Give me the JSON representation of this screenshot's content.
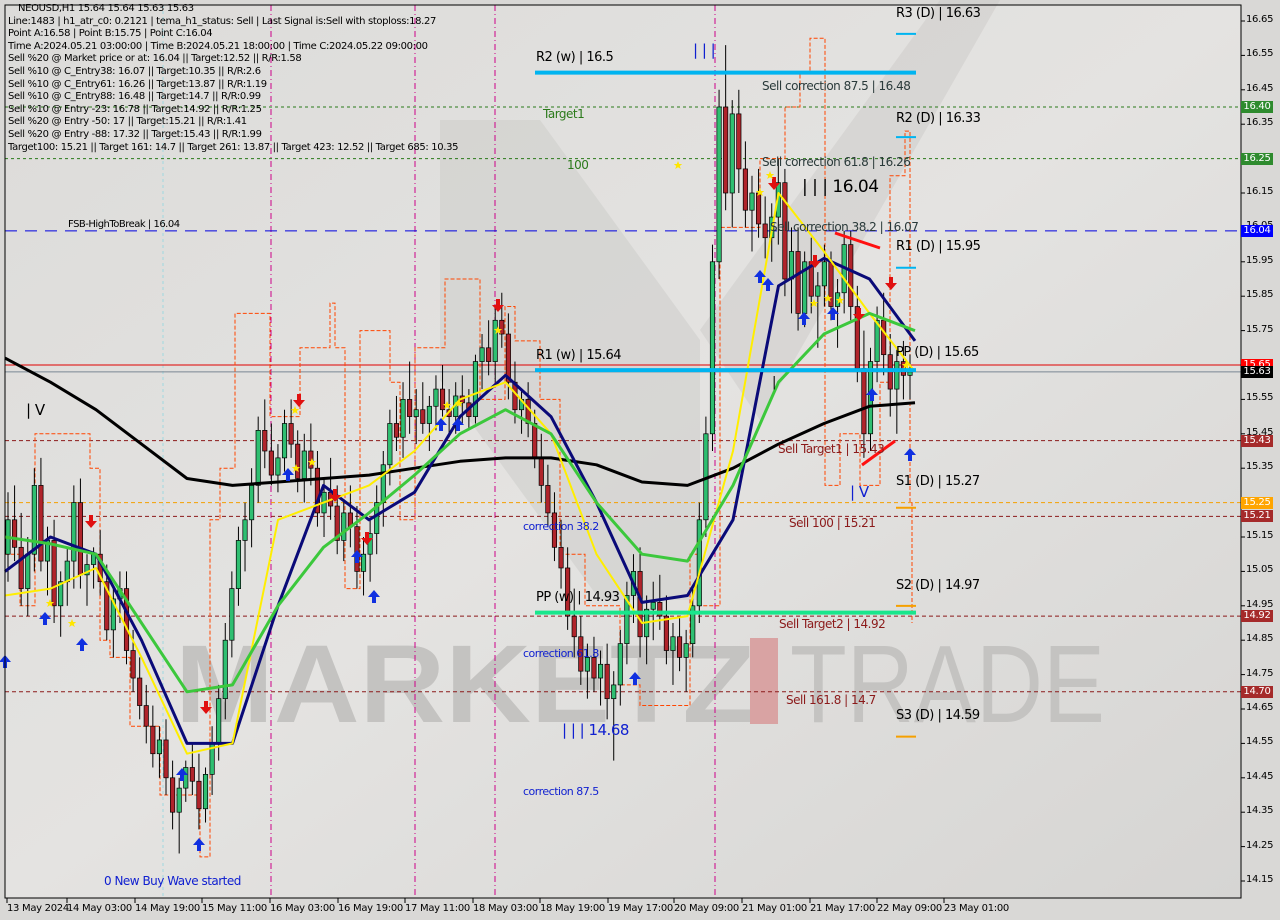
{
  "header": {
    "symbol_line": "NEOUSD,H1  15.64 15.64 15.63 15.63",
    "lines": [
      "Line:1483 | h1_atr_c0: 0.2121 | tema_h1_status: Sell | Last Signal is:Sell with stoploss:18.27",
      "Point A:16.58 | Point B:15.75 | Point C:16.04",
      "Time A:2024.05.21 03:00:00 | Time B:2024.05.21 18:00:00 | Time C:2024.05.22 09:00:00",
      "Sell %20 @ Market price or at: 16.04 || Target:12.52 || R/R:1.58",
      "Sell %10 @ C_Entry38: 16.07 || Target:10.35 || R/R:2.6",
      "Sell %10 @ C_Entry61: 16.26 || Target:13.87 || R/R:1.19",
      "Sell %10 @ C_Entry88: 16.48 || Target:14.7 || R/R:0.99",
      "Sell %10 @ Entry -23: 16.78 || Target:14.92 || R/R:1.25",
      "Sell %20 @ Entry -50: 17 || Target:15.21 || R/R:1.41",
      "Sell %20 @ Entry -88: 17.32 || Target:15.43 || R/R:1.99",
      "Target100: 15.21 || Target 161: 14.7 || Target 261: 13.87 || Target 423: 12.52 || Target 685: 10.35"
    ]
  },
  "watermark": {
    "left": "MARKETZ",
    "right": "TRADE"
  },
  "colors": {
    "background": "#d9d8d6",
    "bull_candle": "#2fbf71",
    "bear_candle": "#b0242b",
    "pivot_weekly": "#00b4f0",
    "pivot_pp_weekly": "#19e68c",
    "pivot_support_daily": "#f5a000",
    "fsb_line": "#0000e0",
    "target_line": "#2a7a1a",
    "sell_level": "#8b1a1a",
    "ma_black": "#000000",
    "ma_navy": "#0a0a78",
    "ma_yellow": "#ffee00",
    "ma_green": "#3cc83c",
    "orange_step": "#ff4500",
    "vline": "#cc0088"
  },
  "chart_data": {
    "type": "candlestick",
    "title": "NEOUSD,H1",
    "ylim": [
      14.1,
      16.7
    ],
    "y_ticks": [
      16.65,
      16.55,
      16.45,
      16.35,
      16.25,
      16.15,
      16.05,
      15.95,
      15.85,
      15.75,
      15.65,
      15.55,
      15.45,
      15.35,
      15.25,
      15.15,
      15.05,
      14.95,
      14.85,
      14.75,
      14.65,
      14.55,
      14.45,
      14.35,
      14.25,
      14.15
    ],
    "x_ticks": [
      "13 May 2024",
      "14 May 03:00",
      "14 May 19:00",
      "15 May 11:00",
      "16 May 03:00",
      "16 May 19:00",
      "17 May 11:00",
      "18 May 03:00",
      "18 May 19:00",
      "19 May 17:00",
      "20 May 09:00",
      "21 May 01:00",
      "21 May 17:00",
      "22 May 09:00",
      "23 May 01:00"
    ],
    "last_price": 15.63,
    "price_tags": [
      {
        "value": 16.4,
        "label": "16.40",
        "color": "#2e8b2e"
      },
      {
        "value": 16.25,
        "label": "16.25",
        "color": "#2e8b2e"
      },
      {
        "value": 16.04,
        "label": "16.04",
        "color": "#0000ff"
      },
      {
        "value": 15.65,
        "label": "15.65",
        "color": "#ff0000"
      },
      {
        "value": 15.63,
        "label": "15.63",
        "color": "#000000"
      },
      {
        "value": 15.43,
        "label": "15.43",
        "color": "#a52a2a"
      },
      {
        "value": 15.25,
        "label": "15.25",
        "color": "#ffa500"
      },
      {
        "value": 15.21,
        "label": "15.21",
        "color": "#a52a2a"
      },
      {
        "value": 14.92,
        "label": "14.92",
        "color": "#a52a2a"
      },
      {
        "value": 14.7,
        "label": "14.70",
        "color": "#a52a2a"
      }
    ],
    "levels": [
      {
        "name": "R2 (w)",
        "value": 16.5,
        "label": "R2 (w) | 16.5",
        "kind": "weekly"
      },
      {
        "name": "R1 (w)",
        "value": 15.64,
        "label": "R1 (w) | 15.64",
        "kind": "weekly"
      },
      {
        "name": "PP (w)",
        "value": 14.93,
        "label": "PP (w) | 14.93",
        "kind": "weekly_pp"
      },
      {
        "name": "R3 (D)",
        "value": 16.63,
        "label": "R3 (D) | 16.63",
        "kind": "daily_r"
      },
      {
        "name": "R2 (D)",
        "value": 16.33,
        "label": "R2 (D) | 16.33",
        "kind": "daily_r"
      },
      {
        "name": "R1 (D)",
        "value": 15.95,
        "label": "R1 (D) | 15.95",
        "kind": "daily_r"
      },
      {
        "name": "PP (D)",
        "value": 15.65,
        "label": "PP (D) | 15.65",
        "kind": "daily_pp"
      },
      {
        "name": "S1 (D)",
        "value": 15.27,
        "label": "S1 (D) | 15.27",
        "kind": "daily_s"
      },
      {
        "name": "S2 (D)",
        "value": 14.97,
        "label": "S2 (D) | 14.97",
        "kind": "daily_s"
      },
      {
        "name": "S3 (D)",
        "value": 14.59,
        "label": "S3 (D) | 14.59",
        "kind": "daily_s"
      }
    ],
    "annotations": [
      {
        "text": "Target1",
        "value": 16.4
      },
      {
        "text": "100",
        "value": 16.25
      },
      {
        "text": "FSB-HighToBreak | 16.04",
        "value": 16.04
      },
      {
        "text": "Sell correction 87.5 | 16.48",
        "value": 16.48
      },
      {
        "text": "Sell correction 61.8 | 16.26",
        "value": 16.26
      },
      {
        "text": "Sell correction 38.2 | 16.07",
        "value": 16.07
      },
      {
        "text": "| | | 16.04",
        "value": 16.15
      },
      {
        "text": "Sell Target1 | 15.43",
        "value": 15.43
      },
      {
        "text": "Sell 100 | 15.21",
        "value": 15.21
      },
      {
        "text": "Sell Target2 | 14.92",
        "value": 14.92
      },
      {
        "text": "Sell 161.8 | 14.7",
        "value": 14.7
      },
      {
        "text": "correction 38.2",
        "value": 15.2
      },
      {
        "text": "correction 61.8",
        "value": 14.8
      },
      {
        "text": "correction 87.5",
        "value": 14.42
      },
      {
        "text": "| | | 14.68",
        "value": 14.61
      },
      {
        "text": "0 New Buy Wave started",
        "value": 14.19
      },
      {
        "text": "| V",
        "value": 15.51
      },
      {
        "text": "| V",
        "value": 15.25
      },
      {
        "text": "| | |",
        "value": 16.55
      },
      {
        "text": "|",
        "value": 15.59
      }
    ],
    "candles_ohlc": [
      [
        15.1,
        15.28,
        15.02,
        15.2
      ],
      [
        15.2,
        15.3,
        15.08,
        15.12
      ],
      [
        15.12,
        15.22,
        14.95,
        15.0
      ],
      [
        15.0,
        15.15,
        14.92,
        15.1
      ],
      [
        15.1,
        15.35,
        15.05,
        15.3
      ],
      [
        15.3,
        15.38,
        15.05,
        15.08
      ],
      [
        15.08,
        15.18,
        14.98,
        15.14
      ],
      [
        15.14,
        15.2,
        14.9,
        14.95
      ],
      [
        14.95,
        15.05,
        14.86,
        15.02
      ],
      [
        15.02,
        15.12,
        14.95,
        15.08
      ],
      [
        15.08,
        15.3,
        15.0,
        15.25
      ],
      [
        15.25,
        15.32,
        15.0,
        15.04
      ],
      [
        15.04,
        15.1,
        14.95,
        15.07
      ],
      [
        15.07,
        15.12,
        15.0,
        15.1
      ],
      [
        15.1,
        15.17,
        14.98,
        15.02
      ],
      [
        15.02,
        15.07,
        14.85,
        14.88
      ],
      [
        14.88,
        15.0,
        14.8,
        14.97
      ],
      [
        14.97,
        15.05,
        14.9,
        15.0
      ],
      [
        15.0,
        15.05,
        14.78,
        14.82
      ],
      [
        14.82,
        14.88,
        14.7,
        14.74
      ],
      [
        14.74,
        14.8,
        14.62,
        14.66
      ],
      [
        14.66,
        14.72,
        14.55,
        14.6
      ],
      [
        14.6,
        14.66,
        14.48,
        14.52
      ],
      [
        14.52,
        14.6,
        14.45,
        14.56
      ],
      [
        14.56,
        14.62,
        14.4,
        14.45
      ],
      [
        14.45,
        14.5,
        14.3,
        14.35
      ],
      [
        14.35,
        14.45,
        14.23,
        14.42
      ],
      [
        14.42,
        14.5,
        14.38,
        14.48
      ],
      [
        14.48,
        14.55,
        14.4,
        14.44
      ],
      [
        14.44,
        14.52,
        14.3,
        14.36
      ],
      [
        14.36,
        14.48,
        14.32,
        14.46
      ],
      [
        14.46,
        14.6,
        14.4,
        14.55
      ],
      [
        14.55,
        14.72,
        14.5,
        14.68
      ],
      [
        14.68,
        14.9,
        14.62,
        14.85
      ],
      [
        14.85,
        15.05,
        14.8,
        15.0
      ],
      [
        15.0,
        15.18,
        14.95,
        15.14
      ],
      [
        15.14,
        15.25,
        15.05,
        15.2
      ],
      [
        15.2,
        15.35,
        15.12,
        15.3
      ],
      [
        15.3,
        15.5,
        15.25,
        15.46
      ],
      [
        15.46,
        15.55,
        15.35,
        15.4
      ],
      [
        15.4,
        15.48,
        15.3,
        15.33
      ],
      [
        15.33,
        15.42,
        15.28,
        15.38
      ],
      [
        15.38,
        15.52,
        15.34,
        15.48
      ],
      [
        15.48,
        15.55,
        15.38,
        15.42
      ],
      [
        15.42,
        15.46,
        15.28,
        15.32
      ],
      [
        15.32,
        15.45,
        15.25,
        15.4
      ],
      [
        15.4,
        15.48,
        15.3,
        15.35
      ],
      [
        15.35,
        15.4,
        15.18,
        15.22
      ],
      [
        15.22,
        15.32,
        15.15,
        15.28
      ],
      [
        15.28,
        15.38,
        15.2,
        15.24
      ],
      [
        15.24,
        15.3,
        15.1,
        15.14
      ],
      [
        15.14,
        15.26,
        15.08,
        15.22
      ],
      [
        15.22,
        15.3,
        15.12,
        15.18
      ],
      [
        15.18,
        15.24,
        15.0,
        15.05
      ],
      [
        15.05,
        15.15,
        14.98,
        15.1
      ],
      [
        15.1,
        15.2,
        15.02,
        15.16
      ],
      [
        15.16,
        15.3,
        15.1,
        15.25
      ],
      [
        15.25,
        15.4,
        15.18,
        15.36
      ],
      [
        15.36,
        15.52,
        15.3,
        15.48
      ],
      [
        15.48,
        15.56,
        15.4,
        15.44
      ],
      [
        15.44,
        15.6,
        15.38,
        15.55
      ],
      [
        15.55,
        15.66,
        15.45,
        15.5
      ],
      [
        15.5,
        15.58,
        15.42,
        15.52
      ],
      [
        15.52,
        15.6,
        15.45,
        15.48
      ],
      [
        15.48,
        15.56,
        15.4,
        15.53
      ],
      [
        15.53,
        15.62,
        15.46,
        15.58
      ],
      [
        15.58,
        15.65,
        15.5,
        15.52
      ],
      [
        15.52,
        15.58,
        15.44,
        15.5
      ],
      [
        15.5,
        15.6,
        15.45,
        15.56
      ],
      [
        15.56,
        15.62,
        15.48,
        15.54
      ],
      [
        15.54,
        15.58,
        15.46,
        15.5
      ],
      [
        15.5,
        15.68,
        15.48,
        15.66
      ],
      [
        15.66,
        15.74,
        15.58,
        15.7
      ],
      [
        15.7,
        15.78,
        15.62,
        15.66
      ],
      [
        15.66,
        15.82,
        15.6,
        15.78
      ],
      [
        15.78,
        15.86,
        15.7,
        15.74
      ],
      [
        15.74,
        15.8,
        15.55,
        15.6
      ],
      [
        15.6,
        15.66,
        15.48,
        15.52
      ],
      [
        15.52,
        15.58,
        15.45,
        15.55
      ],
      [
        15.55,
        15.6,
        15.44,
        15.48
      ],
      [
        15.48,
        15.52,
        15.35,
        15.38
      ],
      [
        15.38,
        15.45,
        15.25,
        15.3
      ],
      [
        15.3,
        15.36,
        15.18,
        15.22
      ],
      [
        15.22,
        15.28,
        15.08,
        15.12
      ],
      [
        15.12,
        15.2,
        15.0,
        15.06
      ],
      [
        15.06,
        15.12,
        14.88,
        14.92
      ],
      [
        14.92,
        15.0,
        14.8,
        14.86
      ],
      [
        14.86,
        14.92,
        14.72,
        14.76
      ],
      [
        14.76,
        14.84,
        14.68,
        14.8
      ],
      [
        14.8,
        14.86,
        14.7,
        14.74
      ],
      [
        14.74,
        14.82,
        14.66,
        14.78
      ],
      [
        14.78,
        14.84,
        14.62,
        14.68
      ],
      [
        14.68,
        14.76,
        14.5,
        14.72
      ],
      [
        14.72,
        14.88,
        14.66,
        14.84
      ],
      [
        14.84,
        15.02,
        14.78,
        14.98
      ],
      [
        14.98,
        15.1,
        14.9,
        15.05
      ],
      [
        15.05,
        15.12,
        14.8,
        14.86
      ],
      [
        14.86,
        14.98,
        14.78,
        14.94
      ],
      [
        14.94,
        15.02,
        14.85,
        14.96
      ],
      [
        14.96,
        15.04,
        14.88,
        14.92
      ],
      [
        14.92,
        14.98,
        14.78,
        14.82
      ],
      [
        14.82,
        14.9,
        14.72,
        14.86
      ],
      [
        14.86,
        14.92,
        14.76,
        14.8
      ],
      [
        14.8,
        14.88,
        14.7,
        14.84
      ],
      [
        14.84,
        15.0,
        14.8,
        14.95
      ],
      [
        14.95,
        15.25,
        14.9,
        15.2
      ],
      [
        15.2,
        15.5,
        15.15,
        15.45
      ],
      [
        15.45,
        16.0,
        15.4,
        15.95
      ],
      [
        15.95,
        16.45,
        15.9,
        16.4
      ],
      [
        16.4,
        16.58,
        16.1,
        16.15
      ],
      [
        16.15,
        16.42,
        16.05,
        16.38
      ],
      [
        16.38,
        16.45,
        16.15,
        16.22
      ],
      [
        16.22,
        16.3,
        16.05,
        16.1
      ],
      [
        16.1,
        16.2,
        15.98,
        16.15
      ],
      [
        16.15,
        16.22,
        16.02,
        16.06
      ],
      [
        16.06,
        16.14,
        15.96,
        16.02
      ],
      [
        16.02,
        16.12,
        15.95,
        16.08
      ],
      [
        16.08,
        16.25,
        16.0,
        16.18
      ],
      [
        16.18,
        16.22,
        15.85,
        15.9
      ],
      [
        15.9,
        16.05,
        15.8,
        15.98
      ],
      [
        15.98,
        16.05,
        15.75,
        15.8
      ],
      [
        15.8,
        15.98,
        15.76,
        15.95
      ],
      [
        15.95,
        16.02,
        15.8,
        15.85
      ],
      [
        15.85,
        15.92,
        15.7,
        15.88
      ],
      [
        15.88,
        16.0,
        15.82,
        15.95
      ],
      [
        15.95,
        15.98,
        15.78,
        15.82
      ],
      [
        15.82,
        15.9,
        15.7,
        15.86
      ],
      [
        15.86,
        16.04,
        15.8,
        16.0
      ],
      [
        16.0,
        16.04,
        15.78,
        15.82
      ],
      [
        15.82,
        15.88,
        15.6,
        15.64
      ],
      [
        15.64,
        15.75,
        15.38,
        15.45
      ],
      [
        15.45,
        15.7,
        15.4,
        15.66
      ],
      [
        15.66,
        15.82,
        15.6,
        15.78
      ],
      [
        15.78,
        15.86,
        15.62,
        15.68
      ],
      [
        15.68,
        15.74,
        15.5,
        15.58
      ],
      [
        15.58,
        15.7,
        15.45,
        15.66
      ],
      [
        15.66,
        15.72,
        15.55,
        15.62
      ],
      [
        15.62,
        15.68,
        15.55,
        15.63
      ]
    ],
    "ma_series": [
      {
        "name": "MA black (long)",
        "color": "#000000",
        "values": [
          15.67,
          15.6,
          15.52,
          15.42,
          15.32,
          15.3,
          15.31,
          15.32,
          15.33,
          15.35,
          15.37,
          15.38,
          15.38,
          15.36,
          15.31,
          15.3,
          15.35,
          15.42,
          15.48,
          15.53,
          15.54
        ]
      },
      {
        "name": "MA navy",
        "color": "#0a0a78",
        "values": [
          15.05,
          15.15,
          15.1,
          14.85,
          14.55,
          14.55,
          14.95,
          15.3,
          15.2,
          15.28,
          15.5,
          15.62,
          15.5,
          15.25,
          14.96,
          14.98,
          15.2,
          15.88,
          15.96,
          15.9,
          15.72
        ]
      },
      {
        "name": "MA yellow",
        "color": "#ffee00",
        "values": [
          14.98,
          15.0,
          15.06,
          14.8,
          14.52,
          14.55,
          15.2,
          15.25,
          15.3,
          15.4,
          15.55,
          15.6,
          15.45,
          15.1,
          14.9,
          14.92,
          15.4,
          16.15,
          15.98,
          15.8,
          15.63
        ]
      },
      {
        "name": "MA green",
        "color": "#3cc83c",
        "values": [
          15.15,
          15.13,
          15.1,
          14.9,
          14.7,
          14.72,
          14.95,
          15.12,
          15.22,
          15.33,
          15.45,
          15.52,
          15.45,
          15.25,
          15.1,
          15.08,
          15.3,
          15.6,
          15.74,
          15.8,
          15.75
        ]
      }
    ]
  }
}
